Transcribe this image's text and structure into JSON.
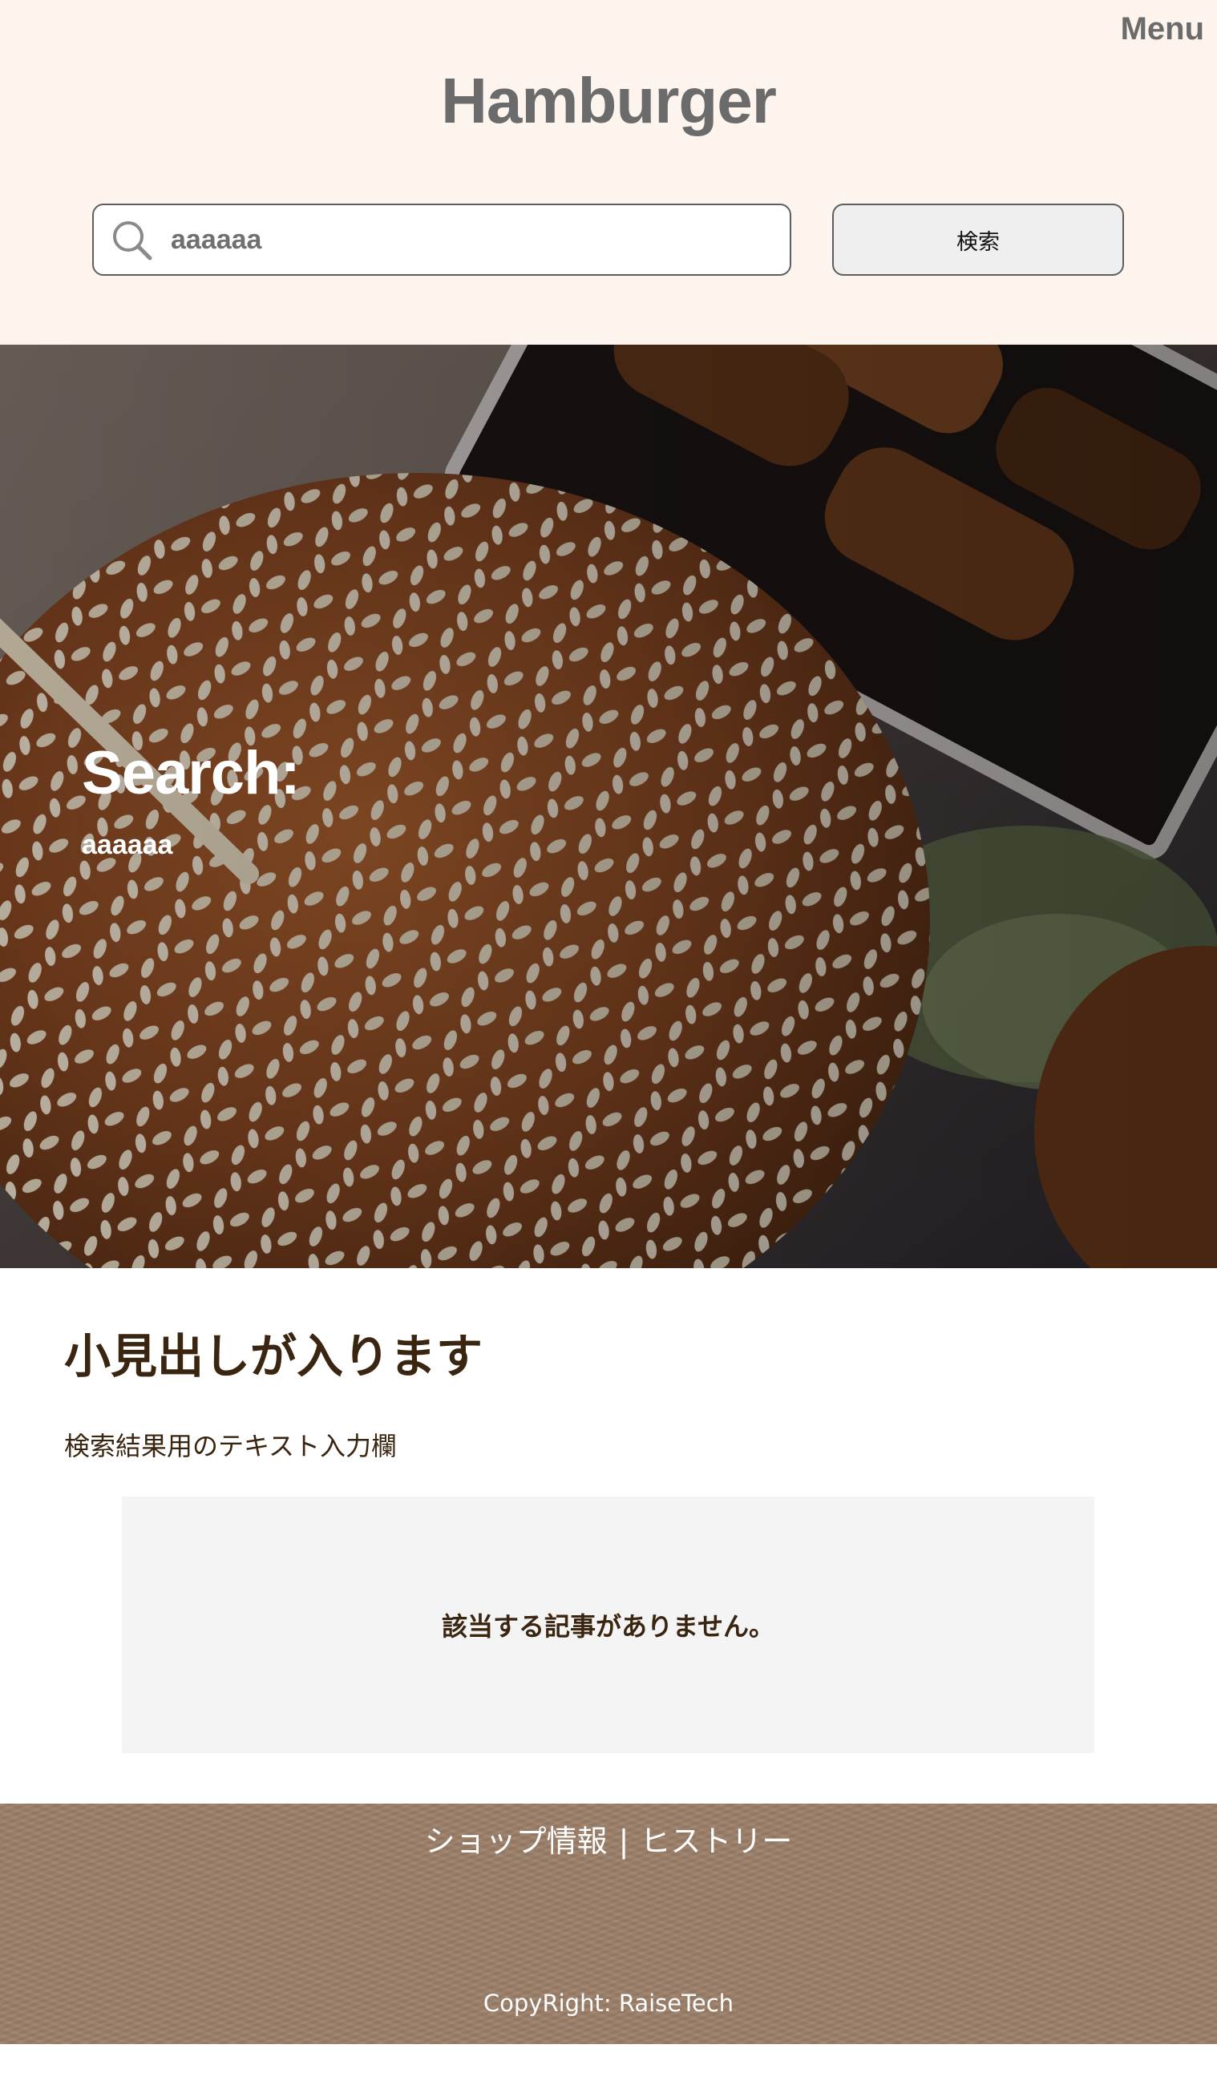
{
  "header": {
    "menu_label": "Menu",
    "site_title": "Hamburger",
    "search": {
      "value": "aaaaaa",
      "placeholder": "",
      "button_label": "検索"
    }
  },
  "hero": {
    "heading": "Search:",
    "query": "aaaaaa"
  },
  "main": {
    "subheading": "小見出しが入ります",
    "text": "検索結果用のテキスト入力欄",
    "no_results_message": "該当する記事がありません。"
  },
  "footer": {
    "nav": [
      {
        "label": "ショップ情報"
      },
      {
        "label": "ヒストリー"
      }
    ],
    "separator": "|",
    "copyright": "CopyRight: RaiseTech"
  },
  "colors": {
    "header_bg": "#fdf4ee",
    "title_gray": "#6b6b6b",
    "heading_brown": "#3a2510",
    "footer_brown": "#9c8069",
    "no_result_bg": "#f4f4f4"
  }
}
